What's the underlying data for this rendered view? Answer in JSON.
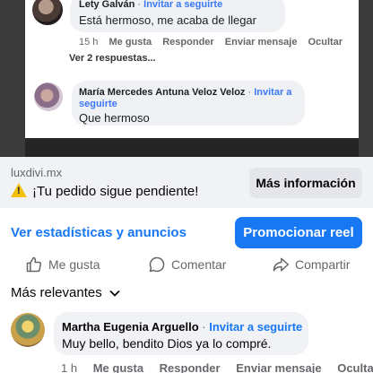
{
  "embedded": {
    "comment1": {
      "author": "Lety Galván",
      "separator": "·",
      "invite": "Invitar a seguirte",
      "text": "Está hermoso, me acaba de llegar",
      "time": "15 h",
      "like": "Me gusta",
      "reply": "Responder",
      "message": "Enviar mensaje",
      "hide": "Ocultar"
    },
    "replies_link": "Ver 2 respuestas...",
    "comment2": {
      "author": "María Mercedes Antuna Veloz Veloz",
      "separator": "·",
      "invite_line1": "Invitar a",
      "invite_line2": "seguirte",
      "text": "Que hermoso"
    }
  },
  "ad": {
    "domain": "luxdivi.mx",
    "title": "¡Tu pedido sigue pendiente!",
    "button": "Más información"
  },
  "insights_link": "Ver estadísticas y anuncios",
  "promote_button": "Promocionar reel",
  "actions": {
    "like": "Me gusta",
    "comment": "Comentar",
    "share": "Compartir"
  },
  "sort": {
    "label": "Más relevantes"
  },
  "comment": {
    "author": "Martha Eugenia Arguello",
    "separator": "·",
    "invite": "Invitar a seguirte",
    "text": "Muy bello, bendito Dios  ya lo compré.",
    "time": "1 h",
    "like": "Me gusta",
    "reply": "Responder",
    "message": "Enviar mensaje",
    "hide": "Ocultar"
  },
  "colors": {
    "accent": "#1877f2",
    "warning": "#f2c00e",
    "muted": "#65676b",
    "bubble": "#f0f2f5"
  },
  "icons": [
    "warning-icon",
    "thumbs-up-icon",
    "comment-icon",
    "share-icon",
    "chevron-down-icon"
  ]
}
